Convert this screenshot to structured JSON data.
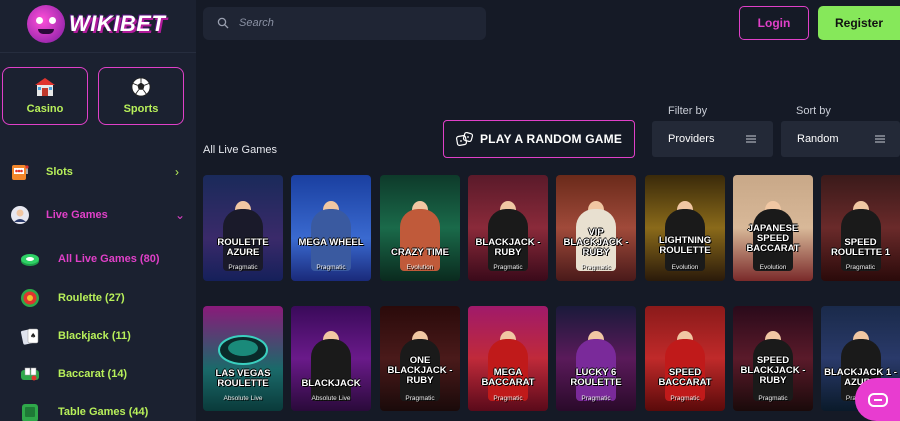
{
  "brand": {
    "name": "WIKIBET"
  },
  "header": {
    "search_placeholder": "Search",
    "login_label": "Login",
    "register_label": "Register"
  },
  "sidebar": {
    "top_buttons": [
      {
        "label": "Casino",
        "icon": "casino-building-icon"
      },
      {
        "label": "Sports",
        "icon": "soccer-ball-icon"
      }
    ],
    "items": [
      {
        "label": "Slots",
        "icon": "slot-machine-icon",
        "chevron": "chevron-right-icon"
      },
      {
        "label": "Live Games",
        "icon": "live-dealer-icon",
        "chevron": "chevron-down-icon",
        "expanded": true
      }
    ],
    "sub_items": [
      {
        "label": "All Live Games (80)",
        "icon": "live-chips-icon",
        "active": true
      },
      {
        "label": "Roulette (27)",
        "icon": "roulette-icon"
      },
      {
        "label": "Blackjack (11)",
        "icon": "blackjack-cards-icon"
      },
      {
        "label": "Baccarat (14)",
        "icon": "baccarat-icon"
      },
      {
        "label": "Table Games (44)",
        "icon": "table-games-icon"
      }
    ]
  },
  "main": {
    "section_title": "All Live Games",
    "random_button_label": "PLAY A RANDOM GAME",
    "filter": {
      "label": "Filter by",
      "value": "Providers"
    },
    "sort": {
      "label": "Sort by",
      "value": "Random"
    }
  },
  "games": {
    "row1": [
      {
        "name": "ROULETTE AZURE",
        "provider": "Pragmatic"
      },
      {
        "name": "MEGA WHEEL",
        "provider": "Pragmatic"
      },
      {
        "name": "CRAZY TIME",
        "provider": "Evolution"
      },
      {
        "name": "BLACKJACK - RUBY",
        "provider": "Pragmatic"
      },
      {
        "name": "VIP BLACKJACK - RUBY",
        "provider": "Pragmatic"
      },
      {
        "name": "LIGHTNING ROULETTE",
        "provider": "Evolution"
      },
      {
        "name": "JAPANESE SPEED BACCARAT",
        "provider": "Evolution"
      },
      {
        "name": "SPEED ROULETTE 1",
        "provider": "Pragmatic"
      }
    ],
    "row2": [
      {
        "name": "LAS VEGAS ROULETTE",
        "provider": "Absolute Live"
      },
      {
        "name": "BLACKJACK",
        "provider": "Absolute Live"
      },
      {
        "name": "ONE BLACKJACK - RUBY",
        "provider": "Pragmatic"
      },
      {
        "name": "MEGA BACCARAT",
        "provider": "Pragmatic"
      },
      {
        "name": "LUCKY 6 ROULETTE",
        "provider": "Pragmatic"
      },
      {
        "name": "SPEED BACCARAT",
        "provider": "Pragmatic"
      },
      {
        "name": "SPEED BLACKJACK - RUBY",
        "provider": "Pragmatic"
      },
      {
        "name": "BLACKJACK 1 - AZURE",
        "provider": "Pragmatic"
      }
    ]
  },
  "colors": {
    "accent_pink": "#e040c8",
    "accent_green": "#86e85a",
    "label_green": "#b8f05a",
    "background": "#151a26",
    "sidebar": "#1b2130"
  }
}
